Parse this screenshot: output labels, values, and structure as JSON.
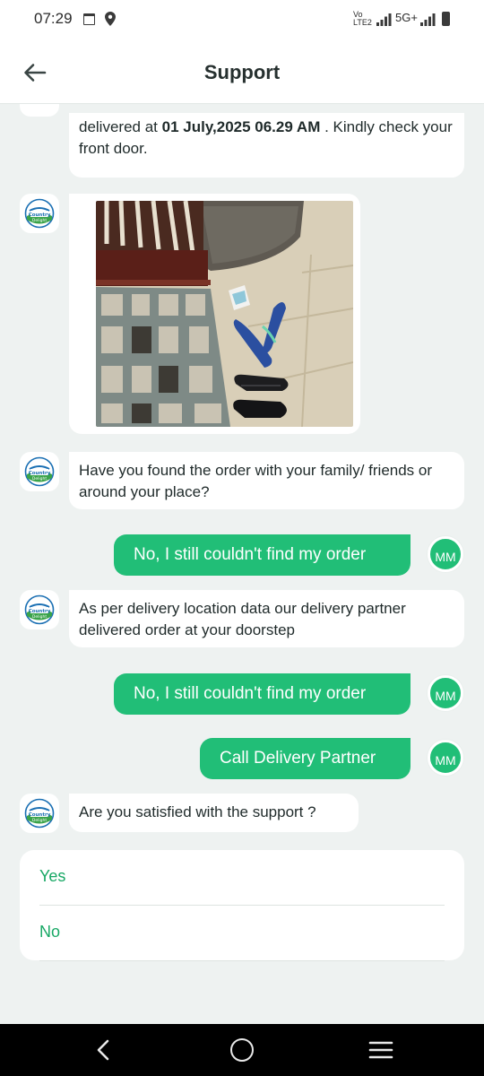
{
  "status_bar": {
    "time": "07:29",
    "volte": "Vo LTE2",
    "network": "5G+",
    "icons": [
      "calendar-icon",
      "location-icon",
      "signal-icon",
      "signal-icon",
      "battery-icon"
    ]
  },
  "header": {
    "title": "Support",
    "back_icon": "arrow-left-icon"
  },
  "messages": {
    "m1_text_start": "delivered at ",
    "m1_text_bold": "01 July,2025 06.29 AM",
    "m1_text_end": " . Kindly check your front door.",
    "m3_text": "Have you found the order with your family/ friends or around your place?",
    "m4_text": "No, I still couldn't find my order",
    "m5_text": "As per delivery location data our delivery partner delivered order at your doorstep",
    "m6_text": "No, I still couldn't find my order",
    "m7_text": "Call Delivery Partner",
    "m8_text": "Are you satisfied with the support ?"
  },
  "user_initials": "MM",
  "bot_logo": {
    "icon": "country-delight-logo",
    "text": "Country Delight"
  },
  "options": [
    {
      "label": "Yes"
    },
    {
      "label": "No"
    }
  ],
  "nav_bar": {
    "icons": [
      "back-chevron-icon",
      "home-circle-icon",
      "recents-menu-icon"
    ]
  },
  "colors": {
    "accent": "#21be77",
    "option_text": "#18a865",
    "background": "#eef2f1",
    "bubble": "#ffffff"
  }
}
